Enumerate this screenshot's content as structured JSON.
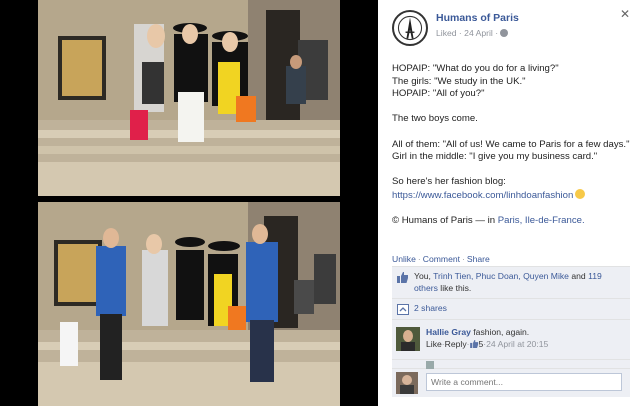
{
  "page": {
    "name": "Humans of Paris",
    "meta": "Liked · 24 April ·",
    "close_glyph": "✕"
  },
  "caption": {
    "line1": "HOPAIP: \"What do you do for a living?\"",
    "line2": "The girls: \"We study in the UK.\"",
    "line3": "HOPAIP: \"All of you?\"",
    "para2": "The two boys come.",
    "para3a": "All of them: \"All of us! We came to Paris for a few days.\"",
    "para3b": "Girl in the middle: \"I give you my business card.\"",
    "para4a": "So here's her fashion blog:",
    "blog_url": "https://www.facebook.com/linhdoanfashion",
    "copyright_prefix": "© Humans of Paris —",
    "location_prefix": "in",
    "location": "Paris, Ile-de-France."
  },
  "actions": {
    "unlike": "Unlike",
    "comment": "Comment",
    "share": "Share",
    "sep": "·"
  },
  "likes": {
    "prefix": "You,",
    "names": "Trinh Tien, Phuc Doan, Quyen Mike",
    "and": "and",
    "others": "119 others",
    "suffix": "like this."
  },
  "shares": {
    "label": "2 shares"
  },
  "comment": {
    "author": "Hallie Gray",
    "text": "fashion, again.",
    "like": "Like",
    "reply": "Reply",
    "likes_count": "5",
    "time": "24 April at 20:15",
    "sep": "·"
  },
  "write_comment": {
    "placeholder": "Write a comment..."
  },
  "colors": {
    "link": "#3b5998",
    "panel_bg": "#ffffff",
    "ufi_bg": "#edeff4"
  }
}
